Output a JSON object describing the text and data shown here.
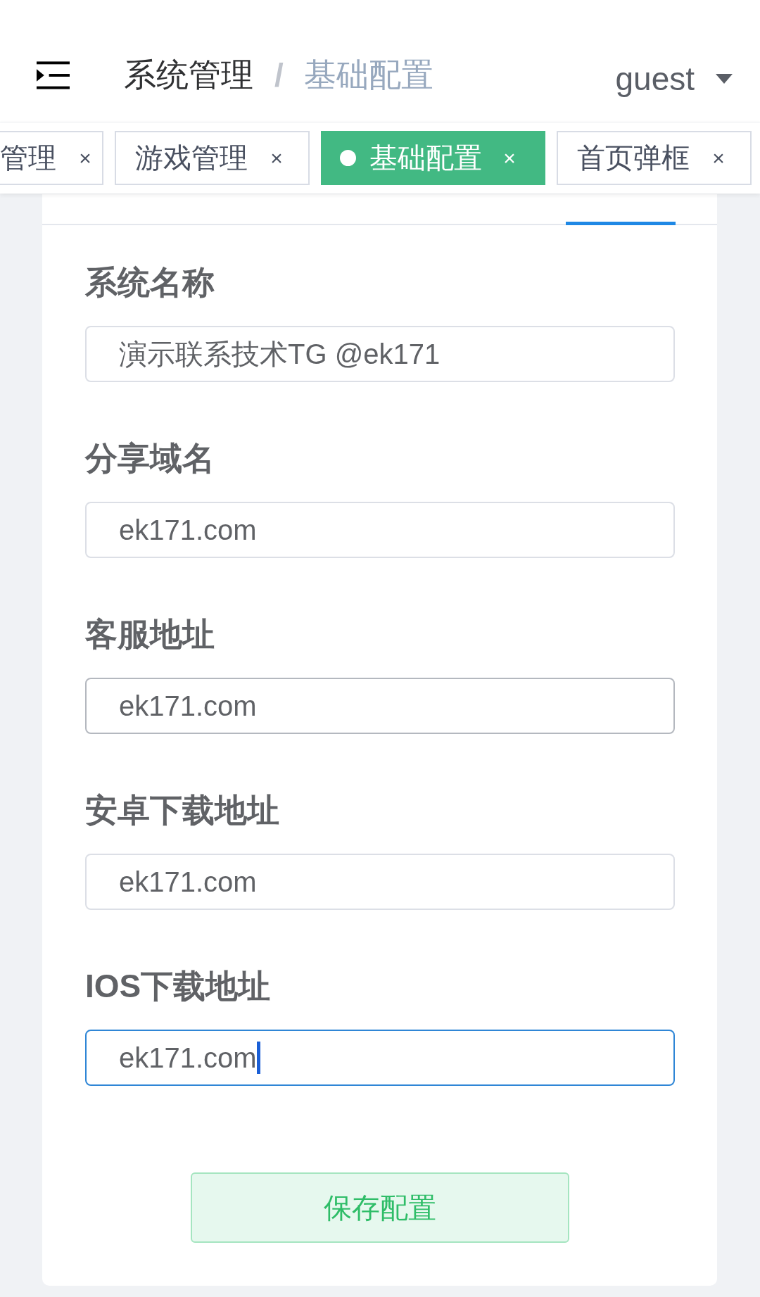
{
  "header": {
    "breadcrumb": {
      "items": [
        {
          "label": "系统管理",
          "current": false
        },
        {
          "label": "基础配置",
          "current": true
        }
      ],
      "separator": "/"
    },
    "user": {
      "name": "guest"
    }
  },
  "tags": [
    {
      "label": "管理",
      "close": "×",
      "selected": false
    },
    {
      "label": "游戏管理",
      "close": "×",
      "selected": false
    },
    {
      "label": "基础配置",
      "close": "×",
      "selected": true
    },
    {
      "label": "首页弹框",
      "close": "×",
      "selected": false
    }
  ],
  "form": {
    "fields": [
      {
        "label": "系统名称",
        "value": "演示联系技术TG @ek171",
        "hovered": false,
        "focused": false
      },
      {
        "label": "分享域名",
        "value": "ek171.com",
        "hovered": false,
        "focused": false
      },
      {
        "label": "客服地址",
        "value": "ek171.com",
        "hovered": true,
        "focused": false
      },
      {
        "label": "安卓下载地址",
        "value": "ek171.com",
        "hovered": false,
        "focused": false
      },
      {
        "label": "IOS下载地址",
        "value": "ek171.com",
        "hovered": false,
        "focused": true
      }
    ],
    "submit": "保存配置"
  }
}
